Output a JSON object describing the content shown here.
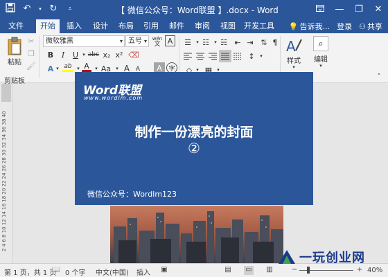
{
  "window": {
    "title": "【 微信公众号：Word联盟 】.docx - Word",
    "qat": [
      "save-icon",
      "undo-icon",
      "redo-icon",
      "customize-icon"
    ],
    "controls": [
      "ribbon-display-icon",
      "minimize-icon",
      "restore-icon",
      "close-icon"
    ]
  },
  "tabs": {
    "items": [
      "文件",
      "开始",
      "插入",
      "设计",
      "布局",
      "引用",
      "邮件",
      "审阅",
      "视图",
      "开发工具"
    ],
    "active": "开始",
    "tell_me": "告诉我...",
    "login": "登录",
    "share": "共享"
  },
  "ribbon": {
    "clipboard": {
      "paste": "粘贴",
      "label": "剪贴板"
    },
    "font": {
      "name": "微软雅黑",
      "size": "五号",
      "wen": "wén",
      "letter_a": "A",
      "bold": "B",
      "italic": "I",
      "underline": "U",
      "strike": "abc",
      "subscript": "x₂",
      "superscript": "x²",
      "text_effects": "A",
      "highlight": "ab",
      "font_color": "A",
      "change_case": "Aa",
      "grow": "A",
      "shrink": "A",
      "char_shade": "A",
      "enclose": "字"
    },
    "styles": {
      "label": "样式"
    },
    "editing": {
      "label": "编辑"
    }
  },
  "ruler": {
    "numbers": "2  4  6  8  10 12 14 16 18 20 22 24 26 28 30 32 34 36 38 40"
  },
  "banner": {
    "logo": "Word联盟",
    "url": "www.wordlm.com",
    "headline": "制作一份漂亮的封面",
    "number": "②",
    "subtitle": "微信公众号：Wordlm123"
  },
  "status": {
    "page": "第 1 页，共 1 页",
    "words": "0 个字",
    "language": "中文(中国)",
    "mode": "插入",
    "zoom": "40%",
    "zoom_fraction": 0.4
  },
  "watermark": {
    "text": "一玩创业网"
  },
  "colors": {
    "accent": "#2b579a",
    "ribbon_bg": "#f3f3f3",
    "font_red": "#c00000",
    "highlight_yellow": "#ffff00"
  }
}
